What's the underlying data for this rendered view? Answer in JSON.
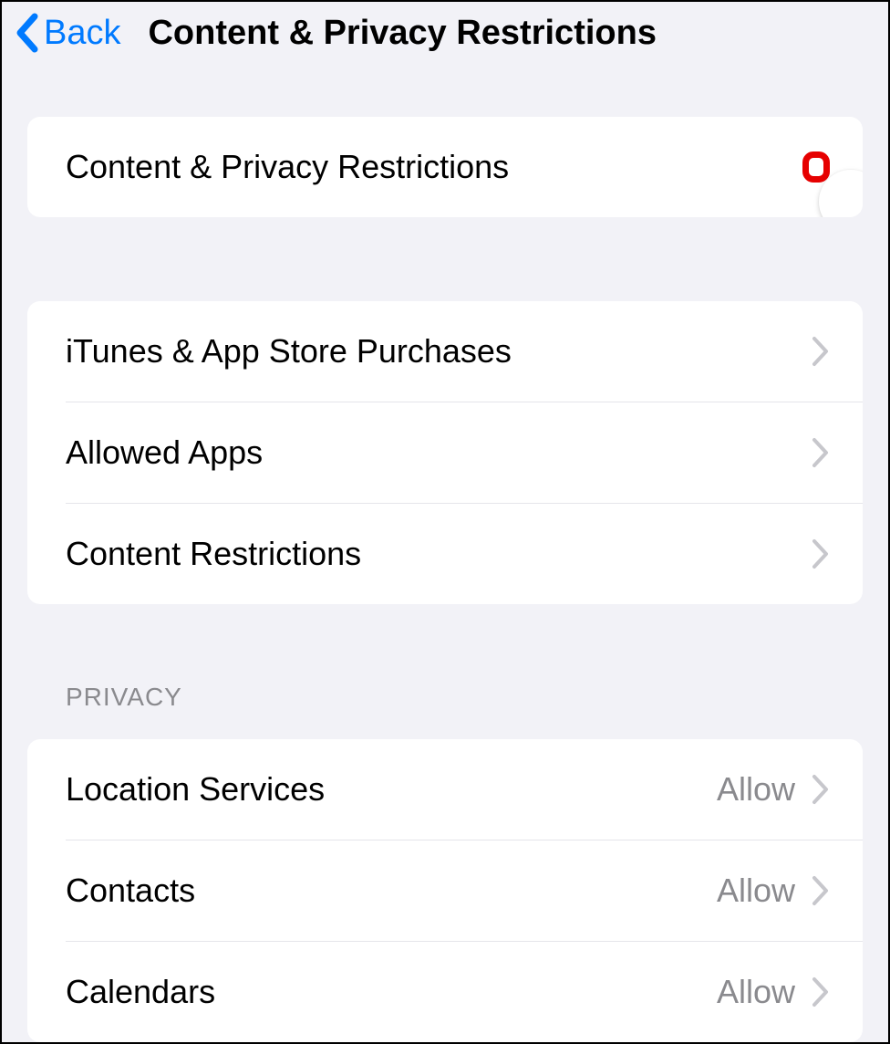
{
  "header": {
    "back_label": "Back",
    "title": "Content & Privacy Restrictions"
  },
  "section1": {
    "row1_label": "Content & Privacy Restrictions",
    "toggle_on": false
  },
  "section2": {
    "items": [
      {
        "label": "iTunes & App Store Purchases"
      },
      {
        "label": "Allowed Apps"
      },
      {
        "label": "Content Restrictions"
      }
    ]
  },
  "privacy_header": "PRIVACY",
  "section3": {
    "items": [
      {
        "label": "Location Services",
        "value": "Allow"
      },
      {
        "label": "Contacts",
        "value": "Allow"
      },
      {
        "label": "Calendars",
        "value": "Allow"
      }
    ]
  }
}
